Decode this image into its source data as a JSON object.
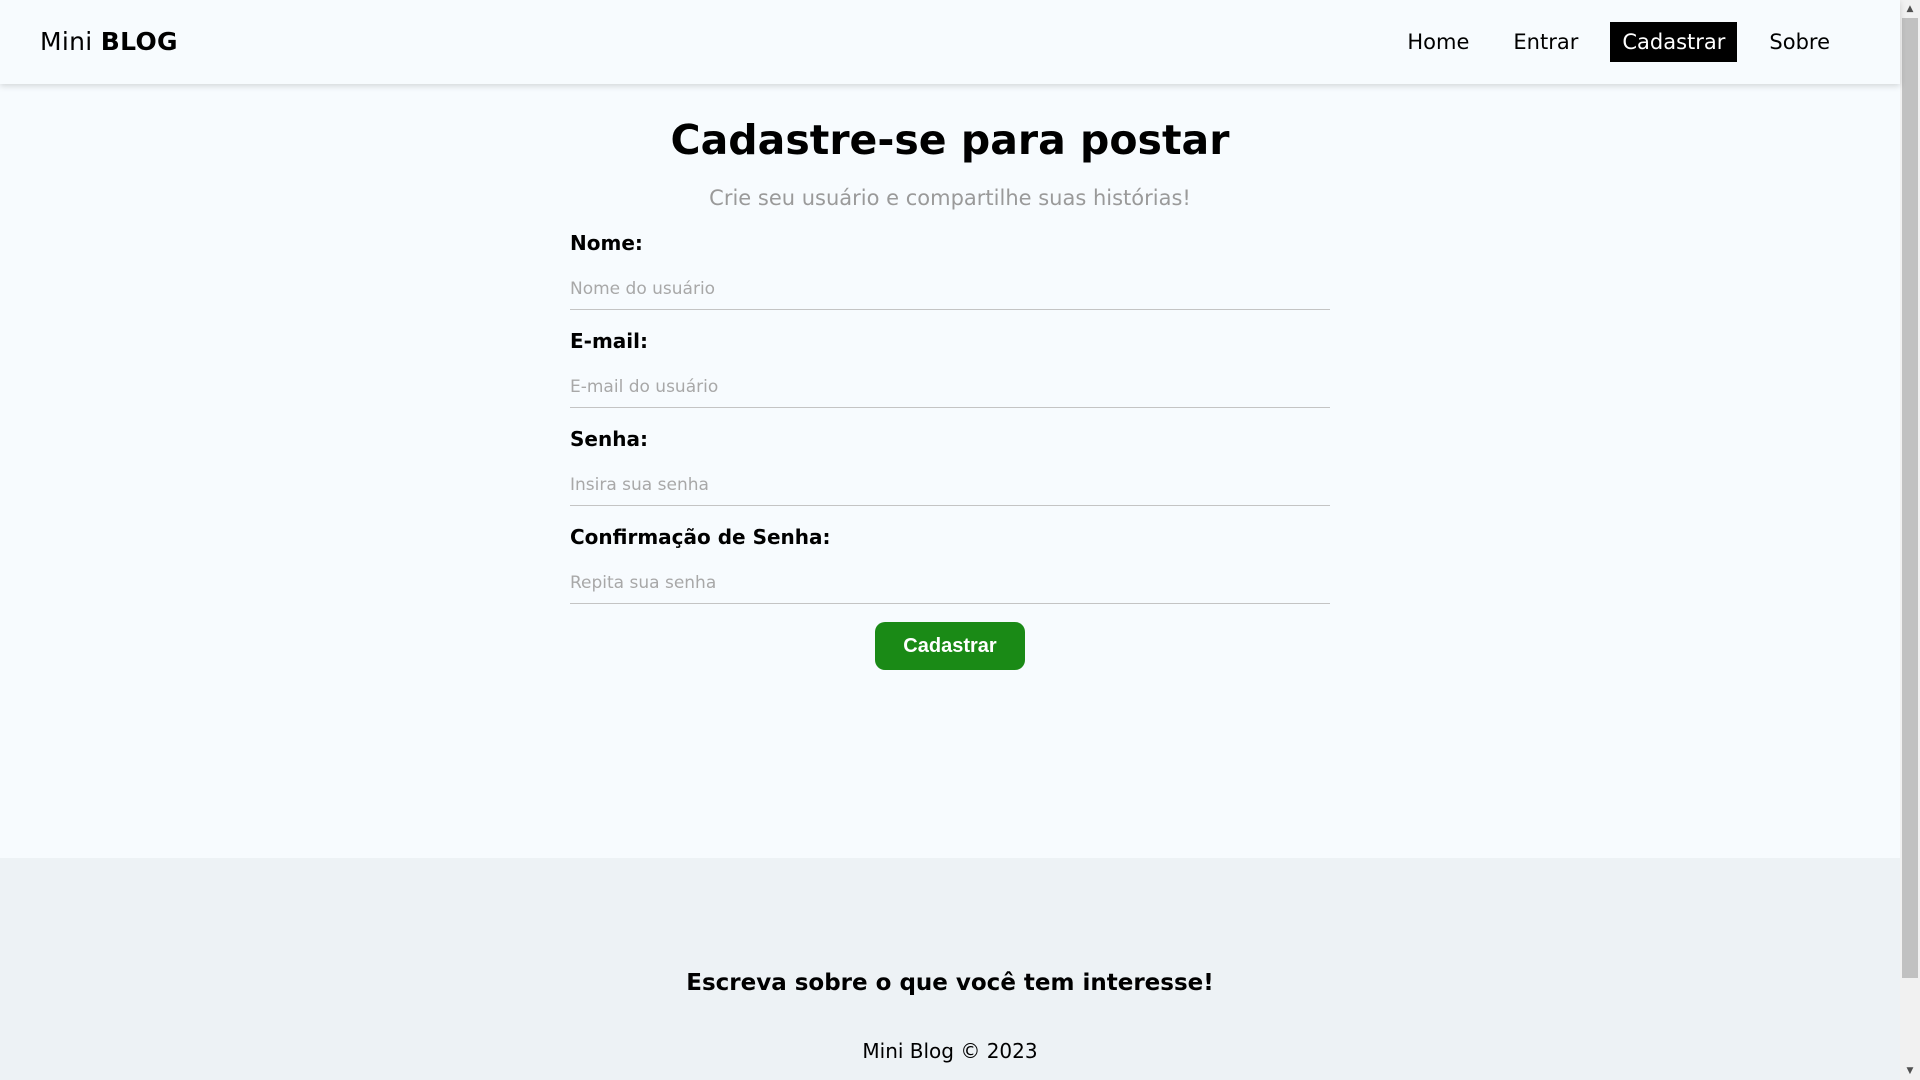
{
  "navbar": {
    "brand_prefix": "Mini",
    "brand_bold": "BLOG",
    "items": [
      {
        "label": "Home",
        "active": false
      },
      {
        "label": "Entrar",
        "active": false
      },
      {
        "label": "Cadastrar",
        "active": true
      },
      {
        "label": "Sobre",
        "active": false
      }
    ]
  },
  "main": {
    "title": "Cadastre-se para postar",
    "subtitle": "Crie seu usuário e compartilhe suas histórias!",
    "fields": [
      {
        "label": "Nome:",
        "placeholder": "Nome do usuário",
        "value": ""
      },
      {
        "label": "E-mail:",
        "placeholder": "E-mail do usuário",
        "value": ""
      },
      {
        "label": "Senha:",
        "placeholder": "Insira sua senha",
        "value": ""
      },
      {
        "label": "Confirmação de Senha:",
        "placeholder": "Repita sua senha",
        "value": ""
      }
    ],
    "submit_label": "Cadastrar"
  },
  "footer": {
    "slogan": "Escreva sobre o que você tem interesse!",
    "copyright": "Mini Blog © 2023"
  },
  "colors": {
    "background": "#f7fbfe",
    "footer_background": "#edf2f5",
    "active_nav_bg": "#000000",
    "submit_button": "#1a8a16",
    "subtitle_text": "#9a9a9a"
  },
  "icons": {
    "scroll_up": "scroll-up-arrow-icon",
    "scroll_down": "scroll-down-arrow-icon"
  }
}
